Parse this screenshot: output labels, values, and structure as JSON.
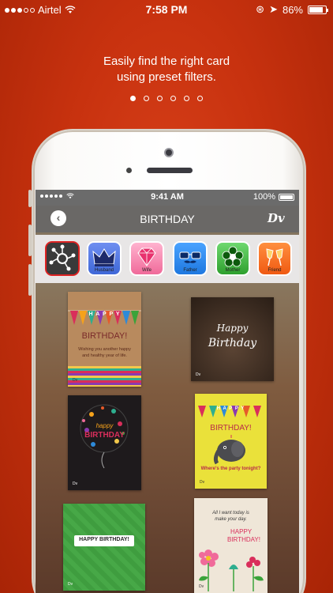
{
  "status": {
    "carrier": "Airtel",
    "time": "7:58 PM",
    "battery": "86%"
  },
  "headline": [
    "Easily find the right card",
    "using preset filters."
  ],
  "pager": {
    "total": 6,
    "active": 0
  },
  "inner_status": {
    "time": "9:41 AM",
    "battery": "100%"
  },
  "navbar": {
    "title": "BIRTHDAY",
    "back": "‹",
    "logo": "Dv"
  },
  "filters": [
    {
      "label": "",
      "icon": "network-icon",
      "color": "#3a3a3a"
    },
    {
      "label": "Husband",
      "icon": "crown-icon",
      "color": "#3f68d8"
    },
    {
      "label": "Wife",
      "icon": "diamond-icon",
      "color": "#f06a9a"
    },
    {
      "label": "Father",
      "icon": "glasses-icon",
      "color": "#1e78e0"
    },
    {
      "label": "Mother",
      "icon": "flower-icon",
      "color": "#3cb43c"
    },
    {
      "label": "Friend",
      "icon": "cheers-icon",
      "color": "#f36a1f"
    }
  ],
  "cards": [
    {
      "lines": [
        "H A P P Y",
        "BIRTHDAY!",
        "Wishing you another happy",
        "and healthy year of life."
      ]
    },
    {
      "lines": [
        "Happy",
        "Birthday"
      ]
    },
    {
      "lines": [
        "happy",
        "BIRTHDAY"
      ]
    },
    {
      "lines": [
        "H A P P Y",
        "BIRTHDAY!",
        "Where's the party tonight?"
      ]
    },
    {
      "lines": [
        "HAPPY BIRTHDAY!"
      ]
    },
    {
      "lines": [
        "All I want today is",
        "make your day.",
        "HAPPY",
        "BIRTHDAY!"
      ]
    }
  ]
}
